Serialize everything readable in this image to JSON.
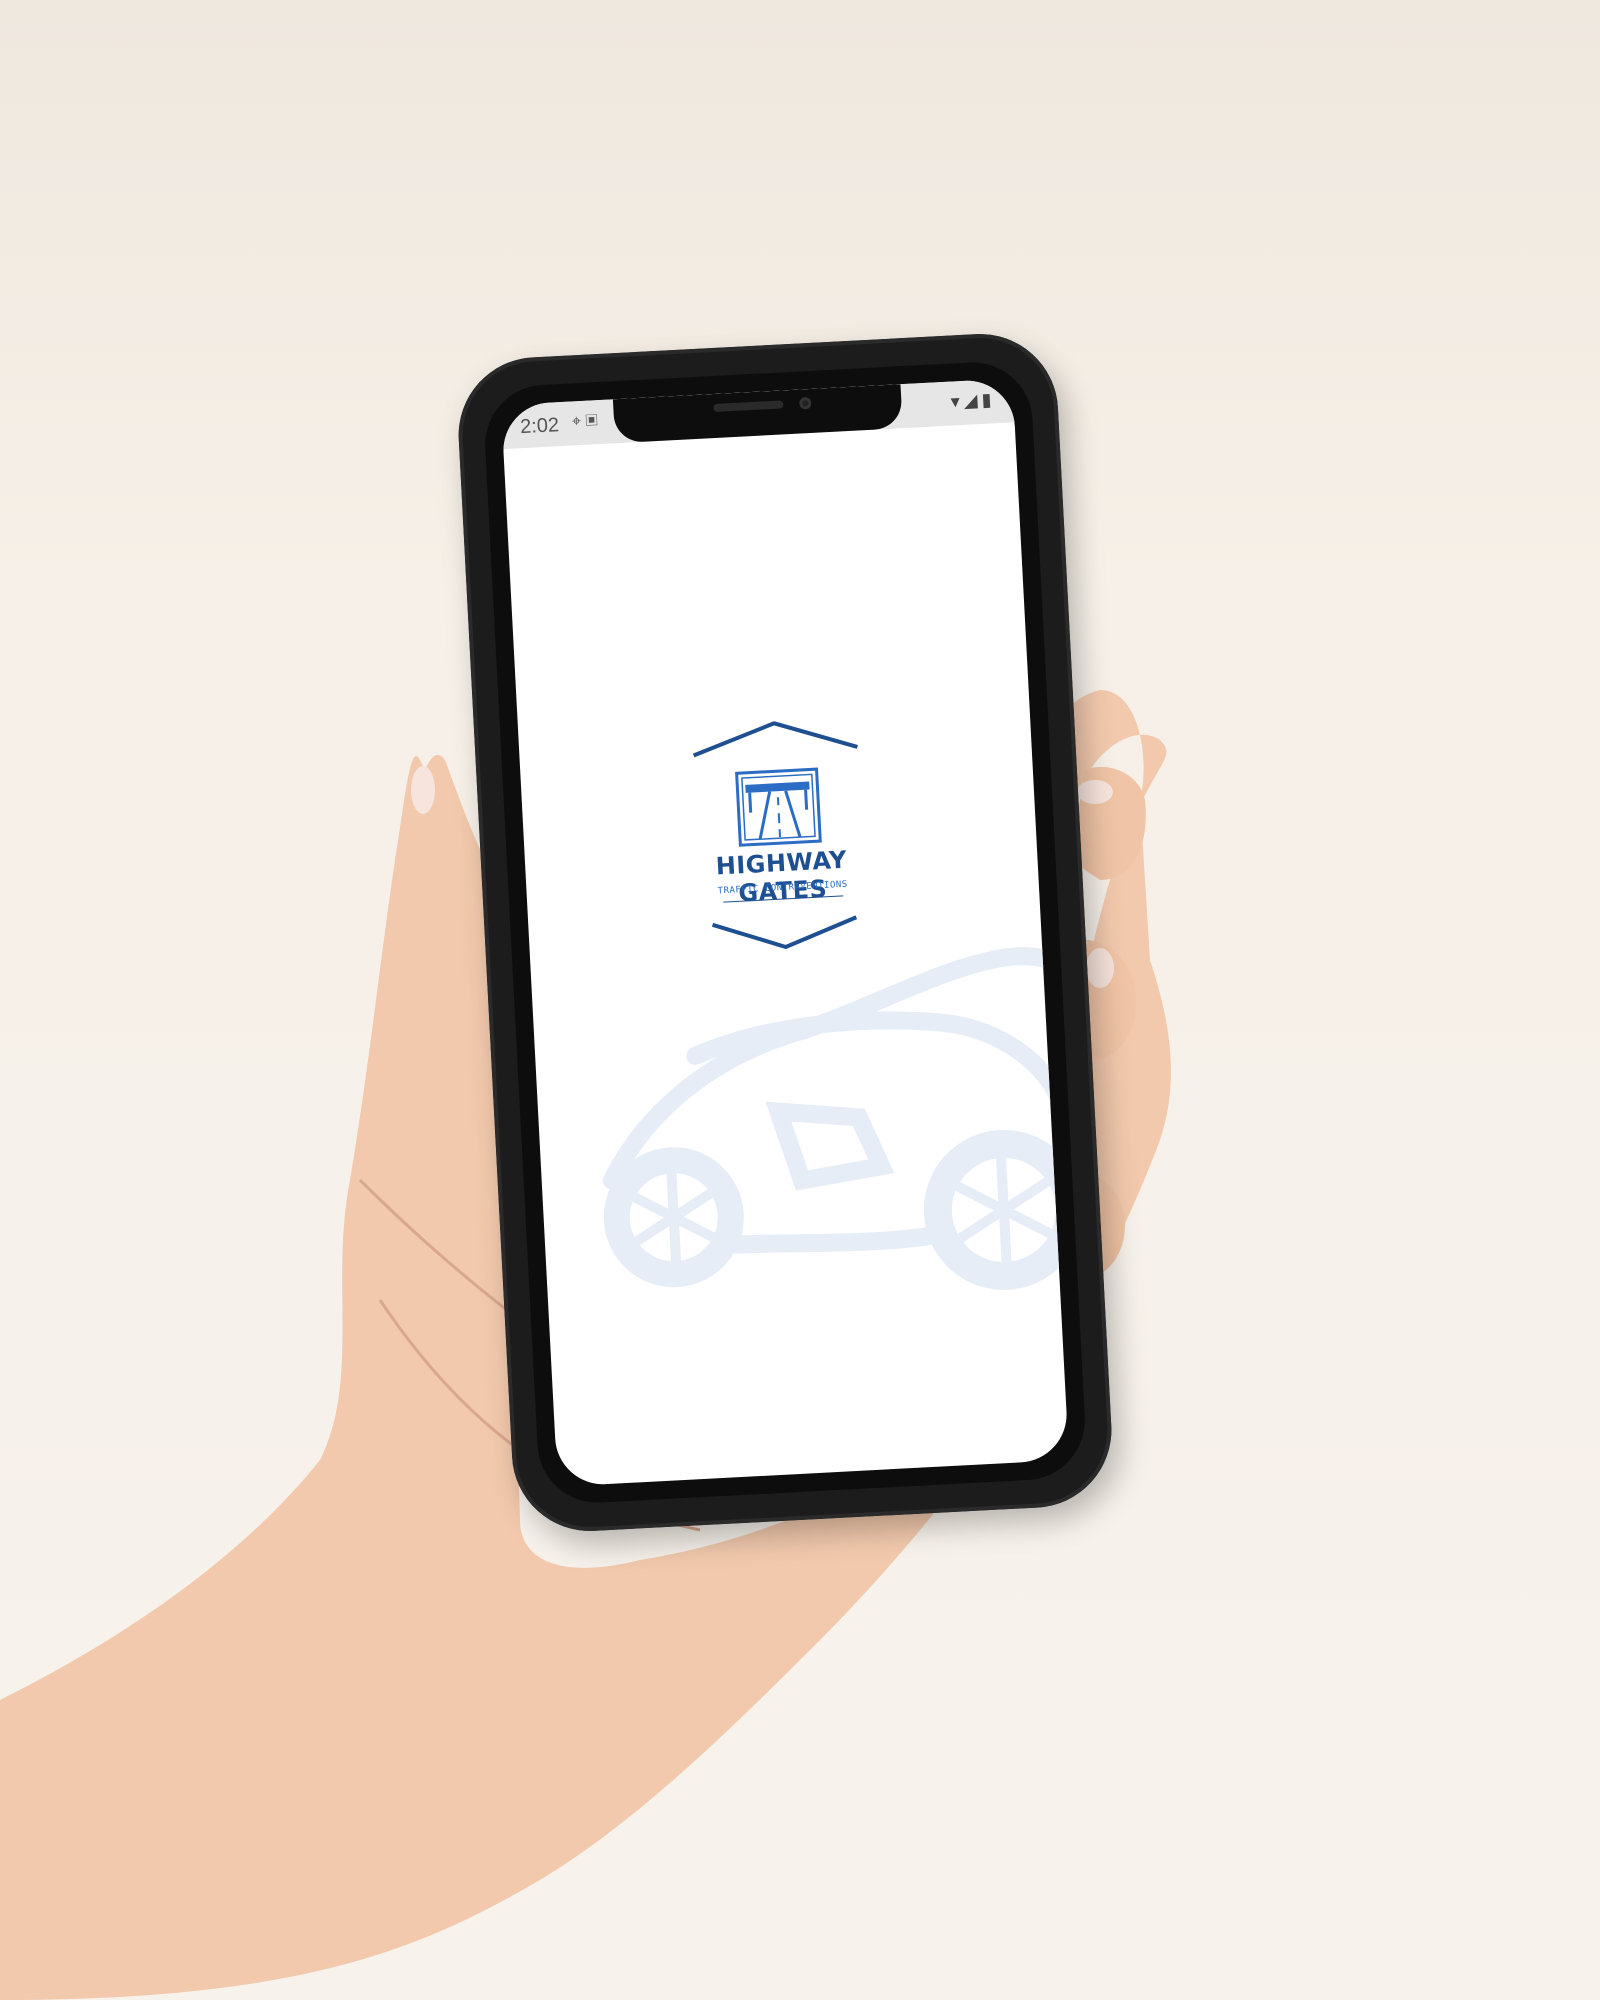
{
  "statusbar": {
    "time": "2:02"
  },
  "brand": {
    "name": "HIGHWAY GATES",
    "tagline": "TRAFFIC CONTRAVENTIONS"
  },
  "colors": {
    "brand_dark": "#1d4f91",
    "brand_light": "#2b6cc4",
    "car_watermark": "#e6edf6",
    "background": "#f6f0e8"
  }
}
